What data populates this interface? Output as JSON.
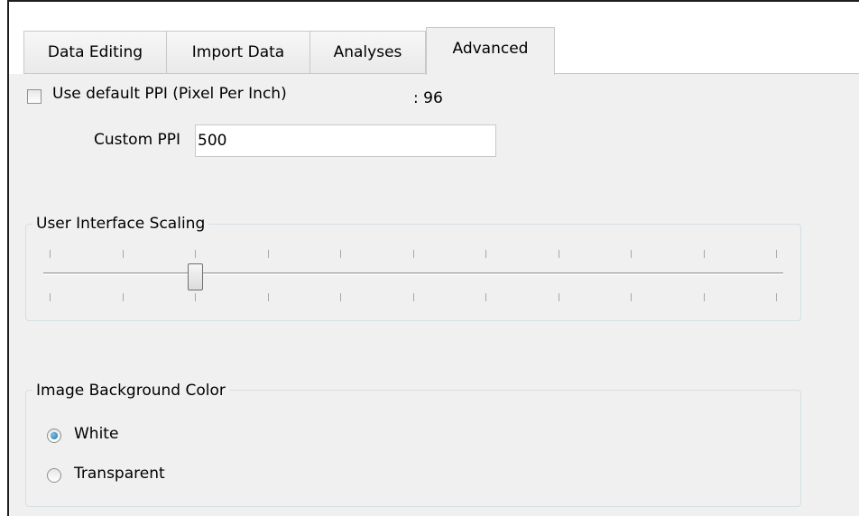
{
  "tabs": [
    {
      "label": "Data Editing"
    },
    {
      "label": "Import Data"
    },
    {
      "label": "Analyses"
    },
    {
      "label": "Advanced",
      "active": true
    }
  ],
  "ppi": {
    "checkbox_label": "Use default PPI (Pixel Per Inch)",
    "checked": false,
    "default_value": ": 96",
    "custom_label": "Custom PPI",
    "custom_value": "500"
  },
  "scaling": {
    "title": "User Interface Scaling",
    "tick_count": 11,
    "selected_tick_index": 2
  },
  "background": {
    "title": "Image Background Color",
    "options": [
      {
        "label": "White",
        "checked": true
      },
      {
        "label": "Transparent",
        "checked": false
      }
    ]
  },
  "colors": {
    "accent": "#1d6fa5",
    "panel": "#f0f0f0",
    "border": "#d5dfe5"
  }
}
